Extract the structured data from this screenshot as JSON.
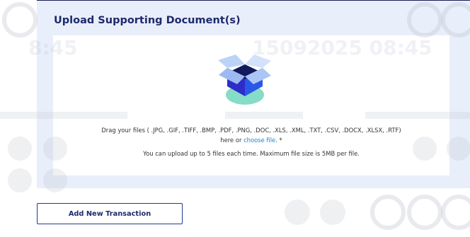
{
  "upload": {
    "title": "Upload Supporting Document(s)",
    "drag_prefix": "Drag your files ( .JPG, .GIF, .TIFF, .BMP, .PDF, .PNG, .DOC, .XLS, .XML, .TXT, .CSV, .DOCX, .XLSX, .RTF)",
    "here_or": "here or",
    "choose_file": "choose file",
    "suffix": ". *",
    "limits": "You can upload up to 5 files each time. Maximum file size is 5MB per file."
  },
  "watermark": {
    "left_text": "8:45",
    "right_text": "15092025 08:45"
  },
  "actions": {
    "add_transaction": "Add New Transaction"
  },
  "colors": {
    "panel_bg": "#e9eefb",
    "title": "#1d2a6b",
    "link": "#1c86c8",
    "button_border": "#223a8f"
  }
}
